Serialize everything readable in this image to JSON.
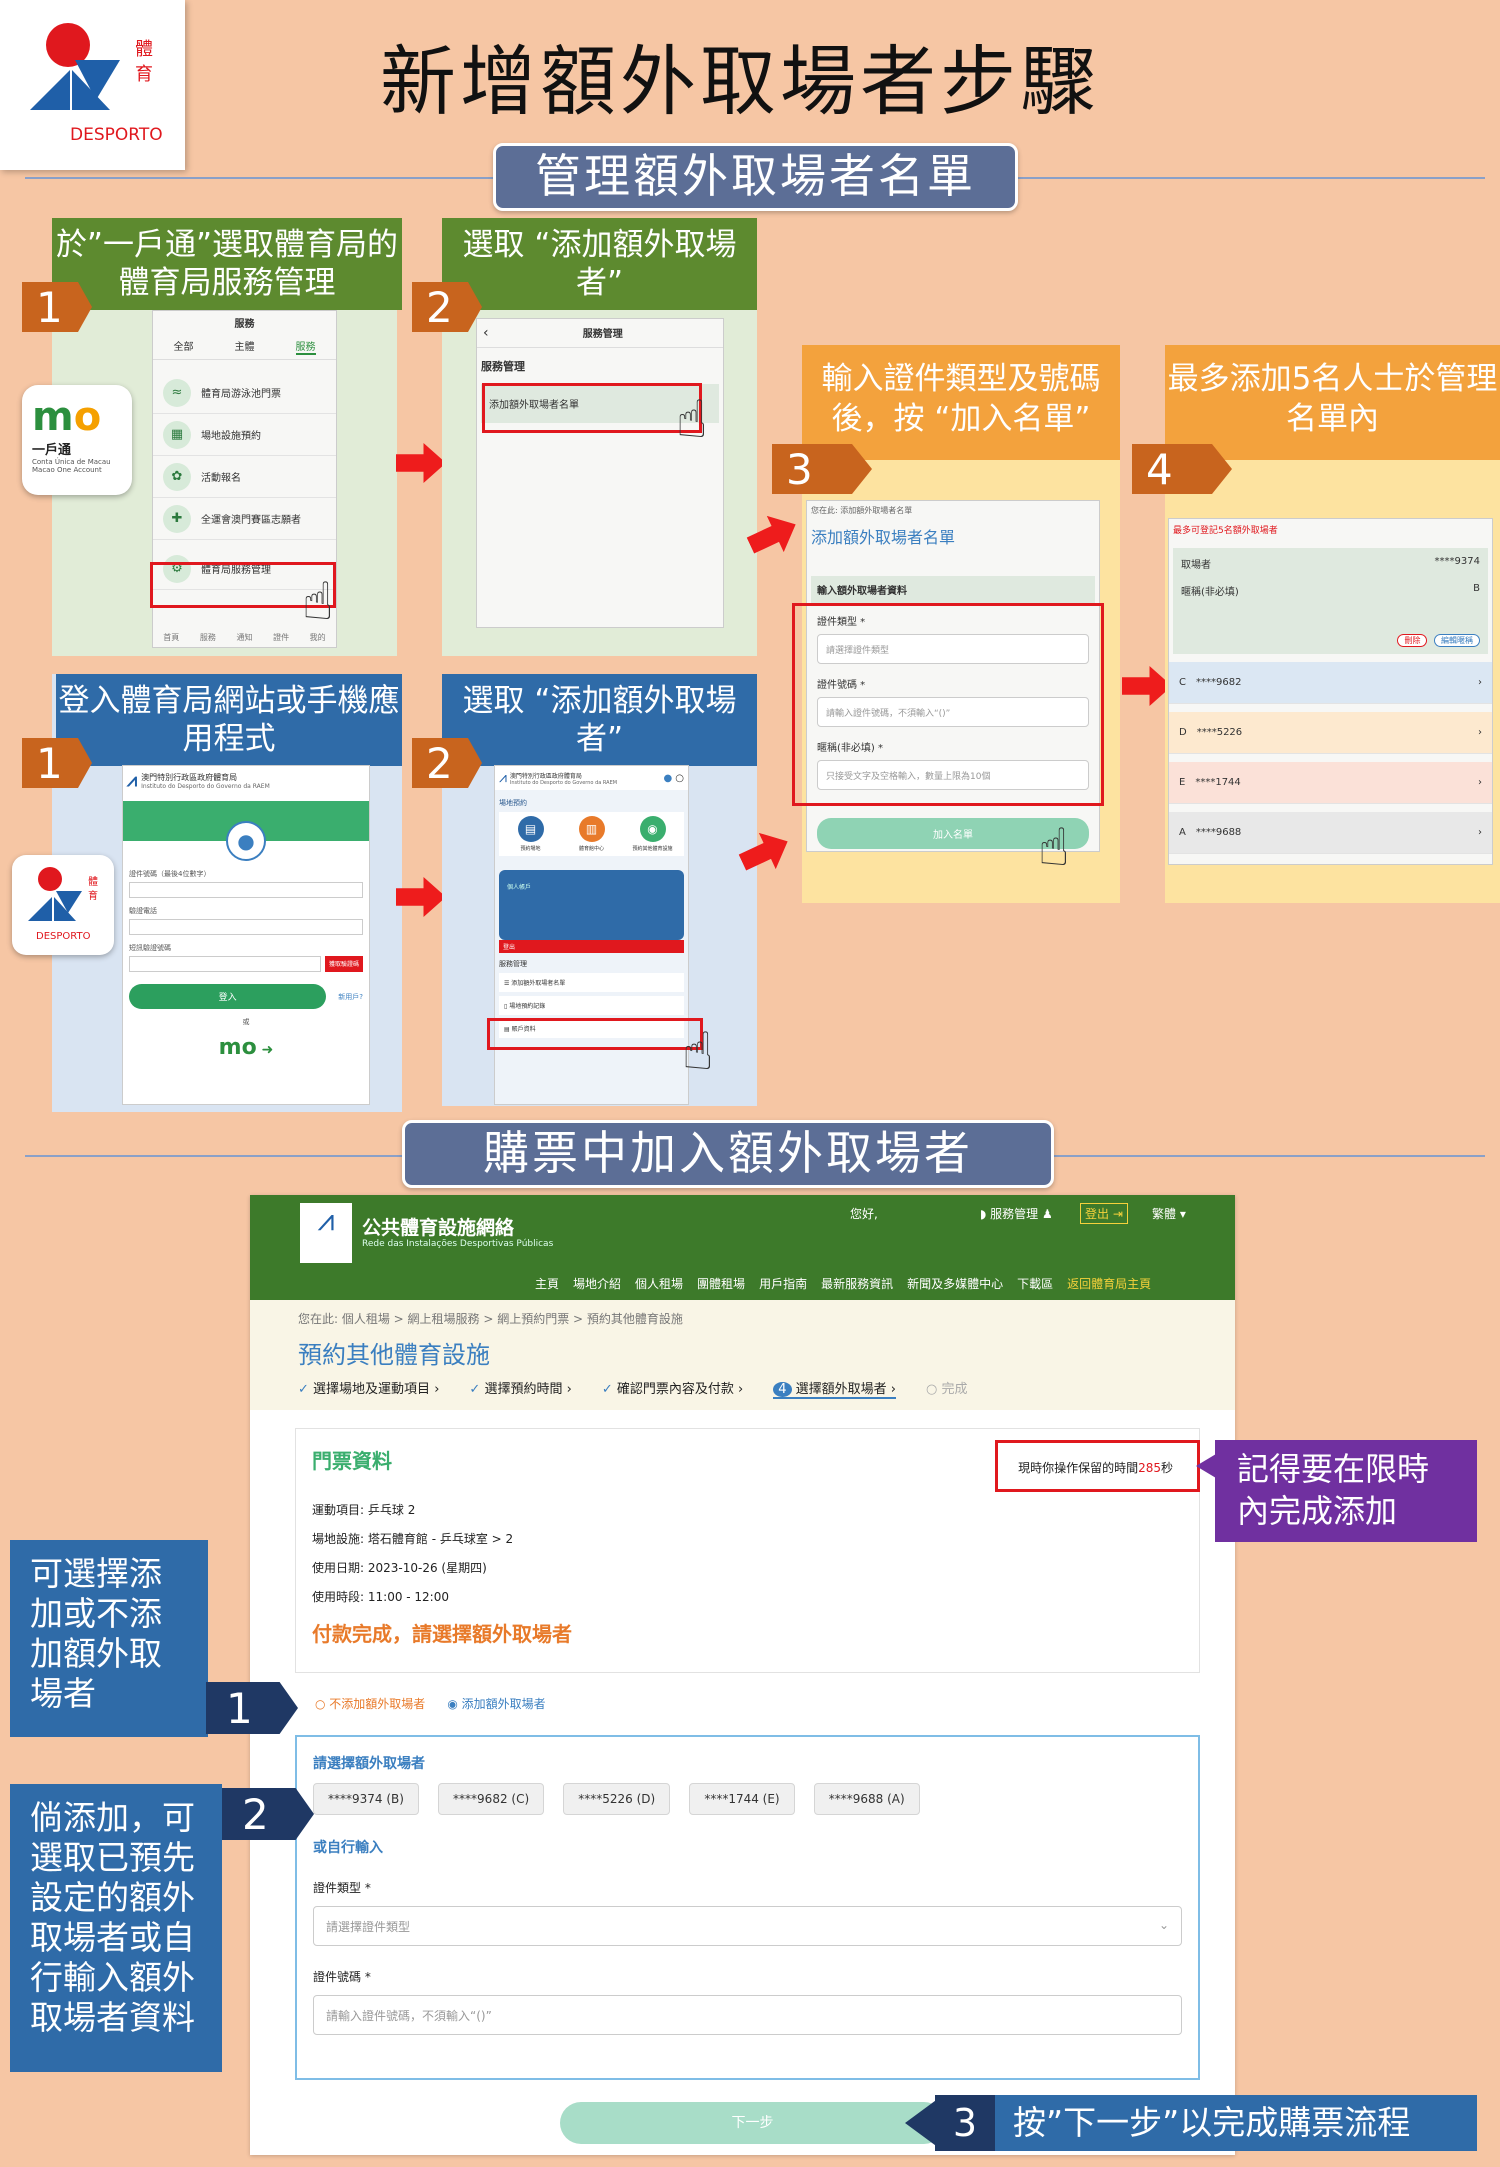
{
  "header": {
    "logo": {
      "badge_text": "體育",
      "brand": "DESPORTO"
    },
    "title": "新增額外取場者步驟"
  },
  "section1": {
    "banner": "管理額外取場者名單",
    "app_logo": {
      "name": "一戶通",
      "sub1": "Conta Única de Macau",
      "sub2": "Macao One Account"
    },
    "step1a": {
      "number": "1",
      "header": "於”一戶通”選取體育局的體育局服務管理",
      "tabs": [
        "全部",
        "主體",
        "服務"
      ],
      "screen_title": "服務",
      "items": [
        "體育局游泳池門票",
        "場地設施預約",
        "活動報名",
        "全運會澳門賽區志願者",
        "體育局服務管理"
      ],
      "bottom_nav": [
        "首頁",
        "服務",
        "通知",
        "證件",
        "我的"
      ]
    },
    "step2a": {
      "number": "2",
      "header": "選取 “添加額外取場者”",
      "screen_title": "服務管理",
      "section_label": "服務管理",
      "item": "添加額外取場者名單"
    },
    "step3": {
      "number": "3",
      "header": "輸入證件類型及號碼後，按 “加入名單”",
      "breadcrumb": "您在此: 添加額外取場者名單",
      "title": "添加額外取場者名單",
      "section": "輸入額外取場者資料",
      "field1_label": "證件類型 *",
      "field1_placeholder": "請選擇證件類型",
      "field2_label": "證件號碼 *",
      "field2_placeholder": "請輸入證件號碼，不須輸入“()”",
      "field3_label": "暱稱(非必填) *",
      "field3_placeholder": "只接受文字及空格輸入，數量上限為10個",
      "button": "加入名單"
    },
    "step4": {
      "number": "4",
      "header": "最多添加5名人士於管理名單內",
      "note": "最多可登記5名額外取場者",
      "card": {
        "id_label": "取場者",
        "id_value": "****9374",
        "nick_label": "暱稱(非必填)",
        "nick_value": "B",
        "btn_delete": "刪除",
        "btn_edit": "編輯暱稱"
      },
      "list": [
        {
          "letter": "C",
          "id": "****9682"
        },
        {
          "letter": "D",
          "id": "****5226"
        },
        {
          "letter": "E",
          "id": "****1744"
        },
        {
          "letter": "A",
          "id": "****9688"
        }
      ]
    },
    "step1b": {
      "number": "1",
      "header": "登入體育局網站或手機應用程式",
      "site_title": "澳門特別行政區政府體育局",
      "site_sub": "Instituto do Desporto do Governo da RAEM",
      "label1": "證件號碼（最後4位數字）",
      "label2": "驗證電話",
      "label3": "短訊驗證號碼",
      "sms_btn": "獲取驗證碼",
      "login": "登入",
      "register": "新用戶?",
      "or": "或"
    },
    "step2b": {
      "number": "2",
      "header": "選取 “添加額外取場者”",
      "site_title": "澳門特別行政區政府體育局",
      "site_sub": "Instituto do Desporto do Governo da RAEM",
      "venue_label": "場地預約",
      "tiles": [
        "預約場地",
        "體育館中心",
        "預約其他體育設施"
      ],
      "banner_text": "個人帳戶",
      "logout": "登出",
      "service_label": "服務管理",
      "menu": [
        "添加額外取場者名單",
        "場地預約記錄",
        "賬戶資料"
      ]
    }
  },
  "section2": {
    "banner": "購票中加入額外取場者",
    "site": {
      "name": "公共體育設施網絡",
      "sub": "Rede das Instalações Desportivas Públicas",
      "greeting": "您好,",
      "service": "服務管理",
      "logout": "登出",
      "lang": "繁體",
      "nav": [
        "主頁",
        "場地介紹",
        "個人租場",
        "團體租場",
        "用戶指南",
        "最新服務資訊",
        "新聞及多媒體中心",
        "下載區",
        "返回體育局主頁"
      ],
      "breadcrumb": "您在此: 個人租場 > 網上租場服務 > 網上預約門票 > 預約其他體育設施",
      "page_title": "預約其他體育設施",
      "steps": [
        "選擇場地及運動項目",
        "選擇預約時間",
        "確認門票內容及付款",
        "選擇額外取場者",
        "完成"
      ],
      "ticket": {
        "title": "門票資料",
        "timer_prefix": "現時你操作保留的時間",
        "timer_value": "285",
        "timer_suffix": "秒",
        "sport_label": "運動項目:",
        "sport": "乒乓球 2",
        "venue_label": "場地設施:",
        "venue": "塔石體育館 - 乒乓球室 > 2",
        "date_label": "使用日期:",
        "date": "2023-10-26 (星期四)",
        "time_label": "使用時段:",
        "time": "11:00 - 12:00",
        "paid_msg": "付款完成，請選擇額外取場者"
      },
      "radio_no": "不添加額外取場者",
      "radio_yes": "添加額外取場者",
      "choose_label": "請選擇額外取場者",
      "chips": [
        "****9374 (B)",
        "****9682 (C)",
        "****5226 (D)",
        "****1744 (E)",
        "****9688 (A)"
      ],
      "or_input": "或自行輸入",
      "id_type_label": "證件類型 *",
      "id_type_placeholder": "請選擇證件類型",
      "id_no_label": "證件號碼 *",
      "id_no_placeholder": "請輸入證件號碼，不須輸入“()”",
      "next": "下一步"
    },
    "callout_timer": "記得要在限時內完成添加",
    "side1": {
      "text": "可選擇添加或不添加額外取場者",
      "number": "1"
    },
    "side2": {
      "text": "倘添加，可選取已預先設定的額外取場者或自行輸入額外取場者資料",
      "number": "2"
    },
    "step3": {
      "number": "3",
      "text": "按”下一步”以完成購票流程"
    }
  },
  "colors": {
    "background": "#f6c6a4",
    "green": "#5d8a2f",
    "blue": "#2f6ba8",
    "orange": "#f3a23d",
    "red": "#e0181e",
    "purple": "#7030a0",
    "navy": "#1f3864"
  }
}
